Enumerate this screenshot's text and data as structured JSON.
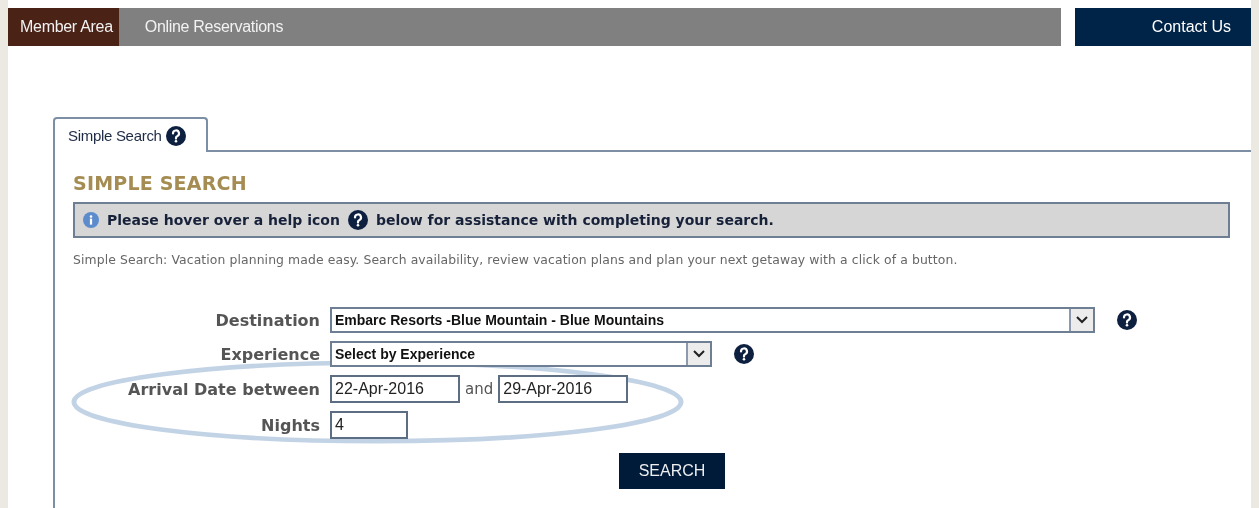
{
  "nav": {
    "items": [
      {
        "label": "Member Area",
        "selected": true
      },
      {
        "label": "Online Reservations",
        "selected": false
      }
    ],
    "contact": "Contact Us"
  },
  "tabs": [
    {
      "label": "Simple Search",
      "selected": true
    }
  ],
  "heading": "SIMPLE SEARCH",
  "info": {
    "before": "Please hover over a help icon",
    "after": "below for assistance with completing your search."
  },
  "description": "Simple Search: Vacation planning made easy. Search availability, review vacation plans and plan your next getaway with a click of a button.",
  "fields": [
    {
      "kind": "select",
      "label": "Destination",
      "value": "Embarc Resorts -Blue Mountain - Blue Mountains",
      "help": true
    },
    {
      "kind": "select",
      "label": "Experience",
      "value": "Select by Experience",
      "help": true
    },
    {
      "kind": "range",
      "label": "Arrival Date between",
      "from": "22-Apr-2016",
      "joiner": "and",
      "to": "29-Apr-2016"
    },
    {
      "kind": "text",
      "label": "Nights",
      "value": "4"
    }
  ],
  "search_button": "SEARCH",
  "annotation": {
    "kind": "ellipse"
  }
}
